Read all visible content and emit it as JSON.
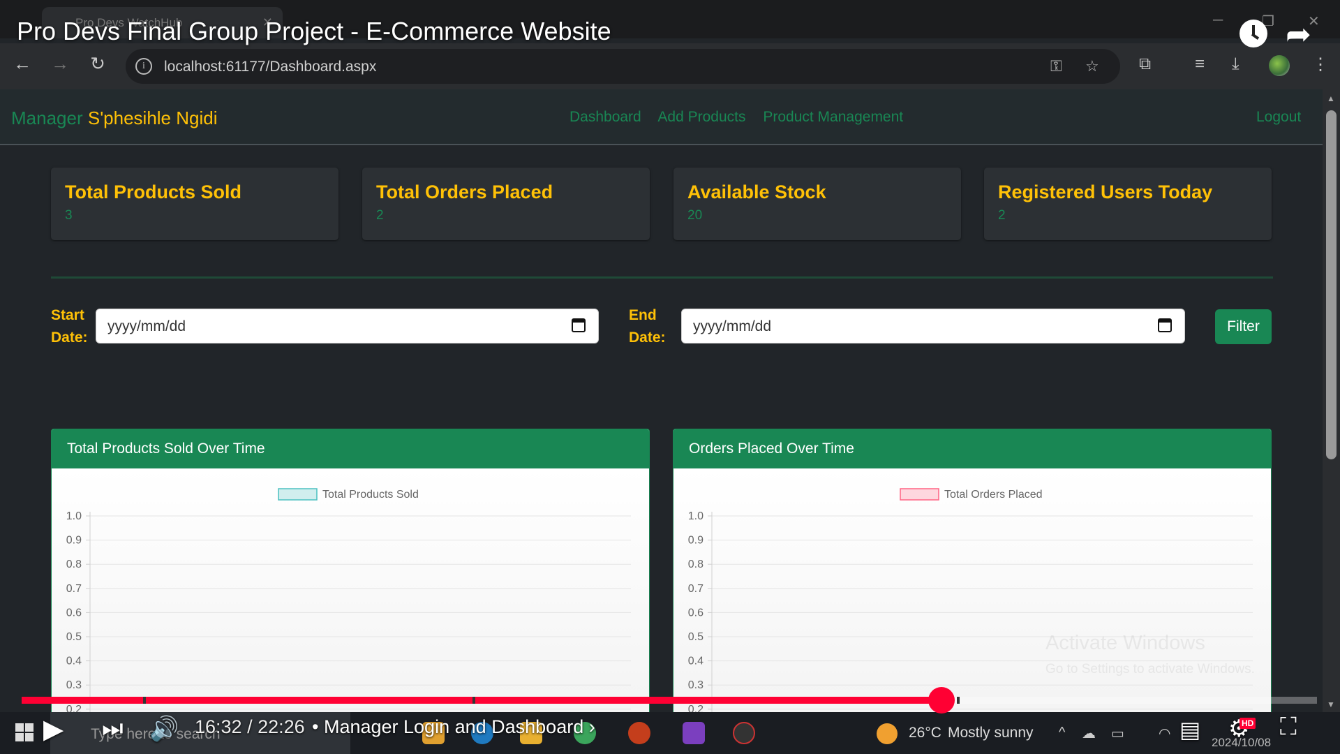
{
  "browser": {
    "tab_title": "Pro Devs WatchHub",
    "url": "localhost:61177/Dashboard.aspx"
  },
  "video": {
    "title": "Pro Devs Final Group Project - E-Commerce Website",
    "time": "16:32 / 22:26",
    "chapter": "• Manager Login and Dashboard ›",
    "progress": 0.71,
    "quality_badge": "HD"
  },
  "navbar": {
    "role": "Manager",
    "user_name": "S'phesihle Ngidi",
    "links": [
      "Dashboard",
      "Add Products",
      "Product Management"
    ],
    "logout": "Logout"
  },
  "stats": [
    {
      "title": "Total Products Sold",
      "value": "3"
    },
    {
      "title": "Total Orders Placed",
      "value": "2"
    },
    {
      "title": "Available Stock",
      "value": "20"
    },
    {
      "title": "Registered Users Today",
      "value": "2"
    }
  ],
  "filter": {
    "start_label_1": "Start",
    "start_label_2": "Date:",
    "end_label_1": "End",
    "end_label_2": "Date:",
    "start_placeholder": "yyyy/mm/dd",
    "end_placeholder": "yyyy/mm/dd",
    "button": "Filter"
  },
  "chart_data": [
    {
      "type": "line",
      "title": "Total Products Sold Over Time",
      "series": [
        {
          "name": "Total Products Sold",
          "values": [],
          "color": "#4bc0c0"
        }
      ],
      "ylim": [
        0,
        1
      ],
      "y_ticks": [
        "1.0",
        "0.9",
        "0.8",
        "0.7",
        "0.6",
        "0.5",
        "0.4",
        "0.3",
        "0.2"
      ],
      "legend": "top",
      "grid": true
    },
    {
      "type": "line",
      "title": "Orders Placed Over Time",
      "series": [
        {
          "name": "Total Orders Placed",
          "values": [],
          "color": "#ff6384"
        }
      ],
      "ylim": [
        0,
        1
      ],
      "y_ticks": [
        "1.0",
        "0.9",
        "0.8",
        "0.7",
        "0.6",
        "0.5",
        "0.4",
        "0.3",
        "0.2"
      ],
      "legend": "top",
      "grid": true
    }
  ],
  "watermark": {
    "line1": "Activate Windows",
    "line2": "Go to Settings to activate Windows."
  },
  "taskbar": {
    "search_placeholder": "Type here to search",
    "temperature": "26°C",
    "weather": "Mostly sunny",
    "date": "2024/10/08"
  }
}
